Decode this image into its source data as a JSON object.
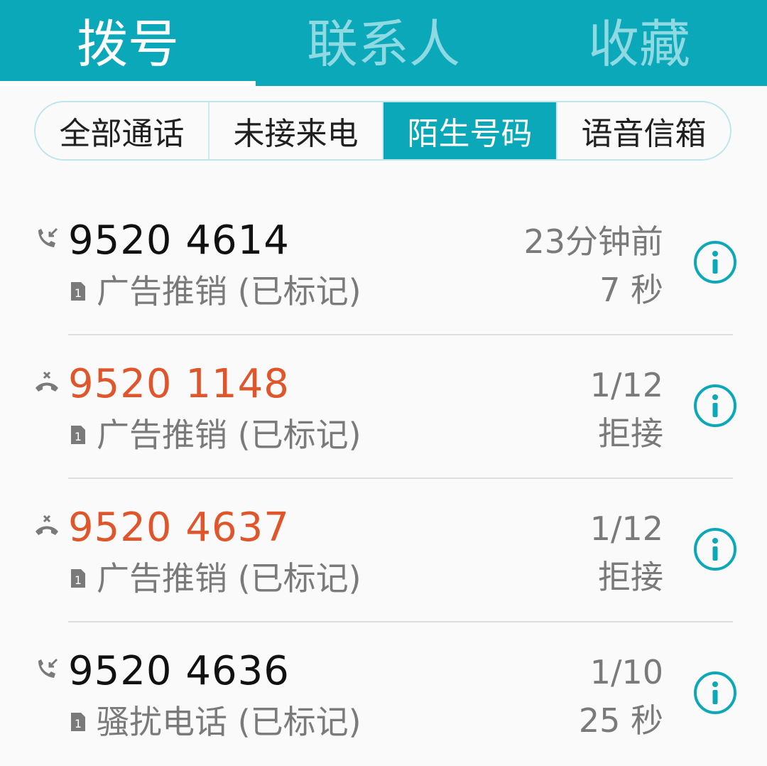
{
  "tabs": [
    {
      "label": "拨号",
      "active": true
    },
    {
      "label": "联系人",
      "active": false
    },
    {
      "label": "收藏",
      "active": false
    }
  ],
  "filters": [
    {
      "label": "全部通话",
      "selected": false
    },
    {
      "label": "未接来电",
      "selected": false
    },
    {
      "label": "陌生号码",
      "selected": true
    },
    {
      "label": "语音信箱",
      "selected": false
    }
  ],
  "calls": [
    {
      "type": "incoming",
      "number": "9520 4614",
      "tag": "广告推销 (已标记)",
      "time": "23分钟前",
      "detail": "7 秒"
    },
    {
      "type": "rejected",
      "number": "9520 1148",
      "tag": "广告推销 (已标记)",
      "time": "1/12",
      "detail": "拒接"
    },
    {
      "type": "rejected",
      "number": "9520 4637",
      "tag": "广告推销 (已标记)",
      "time": "1/12",
      "detail": "拒接"
    },
    {
      "type": "incoming",
      "number": "9520 4636",
      "tag": "骚扰电话 (已标记)",
      "time": "1/10",
      "detail": "25 秒"
    }
  ],
  "colors": {
    "accent": "#0aa8b8",
    "missed": "#e0552a",
    "secondary_text": "#7a7a7a"
  },
  "icons": {
    "incoming": "incoming-call-icon",
    "rejected": "rejected-call-icon",
    "sim": "sim1-icon",
    "info": "info-icon"
  }
}
